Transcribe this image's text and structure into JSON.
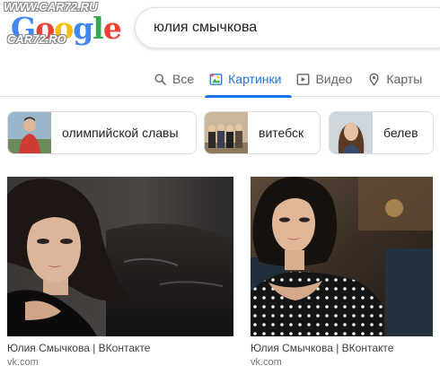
{
  "watermark": {
    "top": "WWW.CAR72.RU",
    "middle": "CAR72.RO"
  },
  "logo": {
    "letters": [
      "G",
      "o",
      "o",
      "g",
      "l",
      "e"
    ]
  },
  "search": {
    "query": "юлия смычкова"
  },
  "tabs": [
    {
      "label": "Все",
      "icon": "search-icon",
      "active": false
    },
    {
      "label": "Картинки",
      "icon": "image-icon",
      "active": true
    },
    {
      "label": "Видео",
      "icon": "play-icon",
      "active": false
    },
    {
      "label": "Карты",
      "icon": "map-pin-icon",
      "active": false
    }
  ],
  "chips": [
    {
      "label": "олимпийской славы",
      "thumb": "person-in-red-thumbnail"
    },
    {
      "label": "витебск",
      "thumb": "group-photo-thumbnail"
    },
    {
      "label": "белев",
      "thumb": "woman-portrait-thumbnail"
    }
  ],
  "results": [
    {
      "title": "Юлия Смычкова | ВКонтакте",
      "site": "vk.com"
    },
    {
      "title": "Юлия Смычкова | ВКонтакте",
      "site": "vk.com"
    }
  ],
  "colors": {
    "accent": "#1a73e8",
    "text": "#202124",
    "muted": "#5f6368",
    "border": "#dfe1e5"
  }
}
